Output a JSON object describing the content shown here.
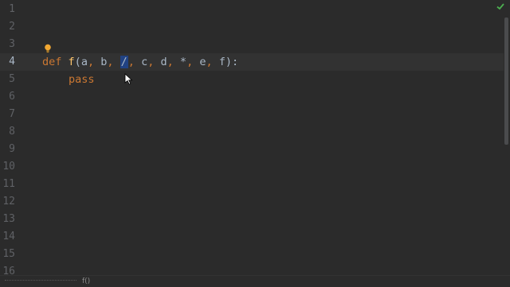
{
  "editor": {
    "line_numbers": [
      "1",
      "2",
      "3",
      "4",
      "5",
      "6",
      "7",
      "8",
      "9",
      "10",
      "11",
      "12",
      "13",
      "14",
      "15",
      "16"
    ],
    "current_line": "4",
    "code": {
      "def_kw": "def",
      "func_name": "f",
      "open_paren": "(",
      "param_a": "a",
      "comma1": ",",
      "param_b": "b",
      "comma2": ",",
      "slash": "/",
      "comma3": ",",
      "param_c": "c",
      "comma4": ",",
      "param_d": "d",
      "comma5": ",",
      "star": "*",
      "comma6": ",",
      "param_e": "e",
      "comma7": ",",
      "param_f": "f",
      "close": "):",
      "pass_kw": "pass"
    }
  },
  "statusbar": {
    "breadcrumb": "f()"
  },
  "colors": {
    "background": "#2b2b2b",
    "keyword": "#cc7832",
    "function": "#ffc66d",
    "text": "#a9b7c6",
    "selection": "#214283",
    "inspection_ok": "#4caf50"
  },
  "icons": {
    "intention": "lightbulb-icon",
    "inspection": "check-icon",
    "pointer": "mouse-cursor-icon"
  }
}
